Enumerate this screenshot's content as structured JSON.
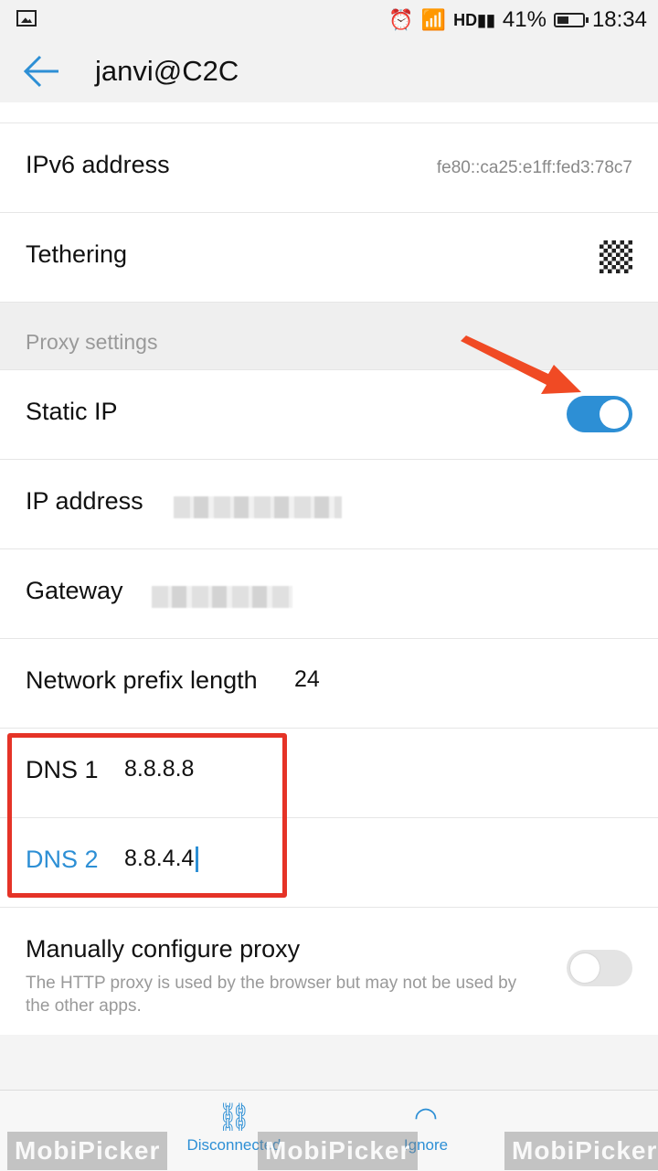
{
  "status_bar": {
    "battery_percent": "41%",
    "time": "18:34",
    "icons": [
      "image-icon",
      "alarm-icon",
      "wifi-icon",
      "hd-signal-icon",
      "signal-icon",
      "battery-icon"
    ]
  },
  "app_bar": {
    "title": "janvi@C2C",
    "back_icon": "back-arrow-icon"
  },
  "rows": {
    "ipv6_label": "IPv6 address",
    "ipv6_value": "fe80::ca25:e1ff:fed3:78c7",
    "tethering_label": "Tethering",
    "proxy_header": "Proxy settings",
    "static_ip_label": "Static IP",
    "static_ip_on": true,
    "ip_address_label": "IP address",
    "gateway_label": "Gateway",
    "prefix_label": "Network prefix length",
    "prefix_value": "24",
    "dns1_label": "DNS 1",
    "dns1_value": "8.8.8.8",
    "dns2_label": "DNS 2",
    "dns2_value": "8.8.4.4",
    "manual_proxy_label": "Manually configure proxy",
    "manual_proxy_desc": "The HTTP proxy is used by the browser but may not be used by the other apps.",
    "manual_proxy_on": false
  },
  "bottom_bar": {
    "disconnect_label": "Disconnected",
    "ignore_label": "Ignore"
  },
  "watermark": "MobiPicker",
  "colors": {
    "accent": "#2d8fd5",
    "highlight": "#e53327"
  }
}
